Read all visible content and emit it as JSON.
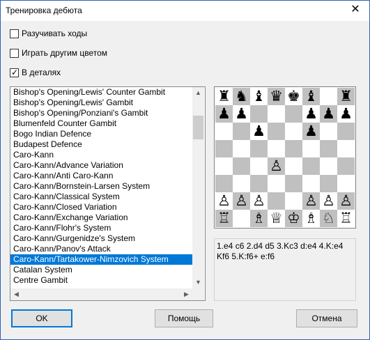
{
  "window": {
    "title": "Тренировка дебюта",
    "close_glyph": "✕"
  },
  "options": [
    {
      "label": "Разучивать ходы",
      "checked": false
    },
    {
      "label": "Играть другим цветом",
      "checked": false
    },
    {
      "label": "В деталях",
      "checked": true
    }
  ],
  "openings": {
    "selected": "Caro-Kann/Tartakower-Nimzovich System",
    "items": [
      "Bishop's Opening/Lewis' Counter Gambit",
      "Bishop's Opening/Lewis' Gambit",
      "Bishop's Opening/Ponziani's Gambit",
      "Blumenfeld Counter Gambit",
      "Bogo Indian Defence",
      "Budapest Defence",
      "Caro-Kann",
      "Caro-Kann/Advance Variation",
      "Caro-Kann/Anti Caro-Kann",
      "Caro-Kann/Bornstein-Larsen System",
      "Caro-Kann/Classical System",
      "Caro-Kann/Closed Variation",
      "Caro-Kann/Exchange Variation",
      "Caro-Kann/Flohr's System",
      "Caro-Kann/Gurgenidze's System",
      "Caro-Kann/Panov's Attack",
      "Caro-Kann/Tartakower-Nimzovich System",
      "Catalan System",
      "Centre Gambit"
    ]
  },
  "board": {
    "light_square": "#ffffff",
    "dark_square": "#c0c0c0",
    "rows": [
      [
        "r",
        "n",
        "b",
        "q",
        "k",
        "b",
        "",
        ""
      ],
      [
        "p",
        "p",
        "",
        "",
        "",
        "p",
        "p",
        "p"
      ],
      [
        "",
        "",
        "p",
        "",
        "",
        "p",
        "",
        ""
      ],
      [
        "",
        "",
        "",
        "",
        "",
        "",
        "",
        ""
      ],
      [
        "",
        "",
        "",
        "",
        "",
        "",
        "",
        ""
      ],
      [
        "",
        "",
        "",
        "",
        "",
        "",
        "",
        ""
      ],
      [
        "P",
        "P",
        "P",
        "",
        "",
        "P",
        "P",
        "P"
      ],
      [
        "R",
        "",
        "B",
        "Q",
        "K",
        "B",
        "N",
        "R"
      ]
    ],
    "extra_pieces": [
      {
        "piece": "r",
        "row": 0,
        "col": 7
      },
      {
        "piece": "P",
        "row": 4,
        "col": 3
      }
    ]
  },
  "notation": "1.e4 c6 2.d4 d5 3.Kc3 d:e4 4.K:e4 Kf6 5.K:f6+ e:f6",
  "buttons": {
    "ok": "OK",
    "help": "Помощь",
    "cancel": "Отмена"
  },
  "scroll": {
    "up": "▲",
    "down": "▼",
    "left": "◀",
    "right": "▶"
  }
}
